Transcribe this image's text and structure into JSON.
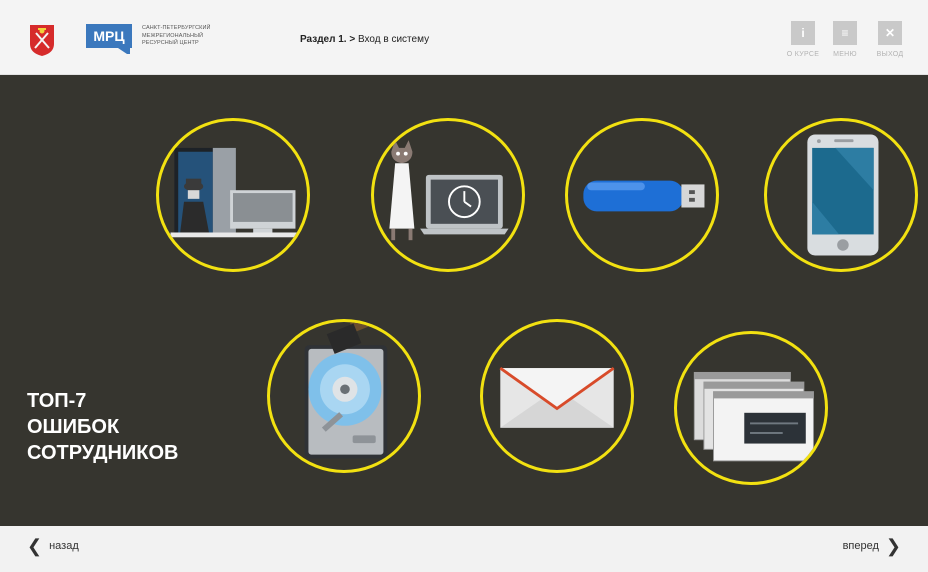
{
  "header": {
    "org_name": [
      "Санкт-Петербургский",
      "межрегиональный",
      "ресурсный центр"
    ],
    "logo_text": "МРЦ",
    "breadcrumb": {
      "section": "Раздел 1.",
      "separator": ">",
      "page": "Вход в систему"
    },
    "buttons": [
      {
        "icon": "i",
        "label": "О КУРСЕ"
      },
      {
        "icon": "≡",
        "label": "МЕНЮ"
      },
      {
        "icon": "✕",
        "label": "ВЫХОД"
      }
    ]
  },
  "main": {
    "title_lines": [
      "ТОП-7",
      "ОШИБОК",
      "СОТРУДНИКОВ"
    ],
    "items": [
      {
        "icon": "spy-at-computer-icon"
      },
      {
        "icon": "cat-laptop-icon"
      },
      {
        "icon": "usb-flash-drive-icon"
      },
      {
        "icon": "smartphone-icon"
      },
      {
        "icon": "hard-drive-hammer-icon"
      },
      {
        "icon": "envelope-icon"
      },
      {
        "icon": "browser-windows-icon"
      }
    ],
    "colors": {
      "background": "#36352f",
      "ring": "#f2e111",
      "logo_blue": "#3b78bd"
    }
  },
  "footer": {
    "back_label": "назад",
    "forward_label": "вперед"
  }
}
